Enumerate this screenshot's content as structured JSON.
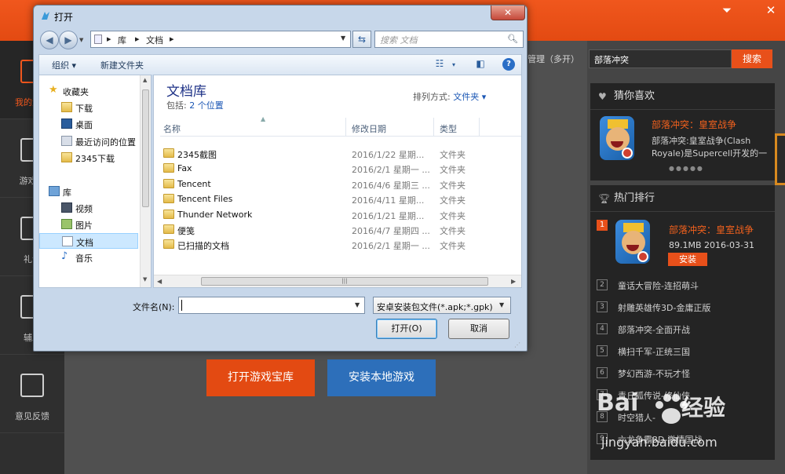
{
  "app": {
    "left_nav": [
      {
        "label": "我的游戏"
      },
      {
        "label": "游戏库"
      },
      {
        "label": "礼包"
      },
      {
        "label": "辅助"
      },
      {
        "label": "意见反馈"
      }
    ],
    "manage_label": "管理（多开）",
    "search_value": "部落冲突",
    "search_button": "搜索",
    "open_library_button": "打开游戏宝库",
    "install_local_button": "安装本地游戏",
    "colors": {
      "accent": "#e8501a",
      "blue": "#2d6fba"
    }
  },
  "guess_panel": {
    "title": "猜你喜欢",
    "game_title": "部落冲突：皇室战争",
    "game_desc": "部落冲突:皇室战争(Clash Royale)是Supercell开发的一",
    "dots": "●●●●●"
  },
  "hot_panel": {
    "title": "热门排行",
    "first": {
      "rank": "1",
      "title": "部落冲突：皇室战争",
      "meta": "89.1MB 2016-03-31",
      "install": "安装"
    },
    "items": [
      {
        "rank": "2",
        "title": "童话大冒险-连招萌斗"
      },
      {
        "rank": "3",
        "title": "射雕英雄传3D-金庸正版"
      },
      {
        "rank": "4",
        "title": "部落冲突-全面开战"
      },
      {
        "rank": "5",
        "title": "横扫千军-正统三国"
      },
      {
        "rank": "6",
        "title": "梦幻西游-不玩才怪"
      },
      {
        "rank": "7",
        "title": "青丘狐传说-修仙侠"
      },
      {
        "rank": "8",
        "title": "时空猎人-"
      },
      {
        "rank": "9",
        "title": "六龙争霸3D-激情国战"
      }
    ]
  },
  "dialog": {
    "title": "打开",
    "close": "✕",
    "address": [
      "库",
      "文档"
    ],
    "search_placeholder": "搜索 文档",
    "toolbar": {
      "organize": "组织 ▾",
      "new_folder": "新建文件夹"
    },
    "nav": [
      {
        "label": "收藏夹",
        "group": true,
        "icon": "star-icon"
      },
      {
        "label": "下载",
        "icon": "download-folder-icon"
      },
      {
        "label": "桌面",
        "icon": "desktop-icon"
      },
      {
        "label": "最近访问的位置",
        "icon": "recent-places-icon"
      },
      {
        "label": "2345下载",
        "icon": "folder-icon"
      },
      {
        "label": "库",
        "group": true,
        "icon": "library-icon"
      },
      {
        "label": "视频",
        "icon": "video-library-icon"
      },
      {
        "label": "图片",
        "icon": "picture-library-icon"
      },
      {
        "label": "文档",
        "icon": "document-library-icon",
        "selected": true
      },
      {
        "label": "音乐",
        "icon": "music-library-icon"
      }
    ],
    "library_title": "文档库",
    "includes_prefix": "包括:",
    "includes_link": "2 个位置",
    "sort_label": "排列方式:",
    "sort_value": "文件夹 ▾",
    "columns": {
      "name": "名称",
      "date": "修改日期",
      "type": "类型"
    },
    "files": [
      {
        "name": "2345截图",
        "date": "2016/1/22 星期...",
        "type": "文件夹"
      },
      {
        "name": "Fax",
        "date": "2016/2/1 星期一 ...",
        "type": "文件夹"
      },
      {
        "name": "Tencent",
        "date": "2016/4/6 星期三 ...",
        "type": "文件夹"
      },
      {
        "name": "Tencent Files",
        "date": "2016/4/11 星期...",
        "type": "文件夹"
      },
      {
        "name": "Thunder Network",
        "date": "2016/1/21 星期...",
        "type": "文件夹"
      },
      {
        "name": "便笺",
        "date": "2016/4/7 星期四 ...",
        "type": "文件夹"
      },
      {
        "name": "已扫描的文档",
        "date": "2016/2/1 星期一 ...",
        "type": "文件夹"
      }
    ],
    "filename_label": "文件名(N):",
    "filename_value": "",
    "filetype_value": "安卓安装包文件(*.apk;*.gpk)",
    "open_button": "打开(O)",
    "cancel_button": "取消"
  },
  "watermark": {
    "logo": "Bai",
    "cn": "经验",
    "url": "jingyan.baidu.com"
  }
}
